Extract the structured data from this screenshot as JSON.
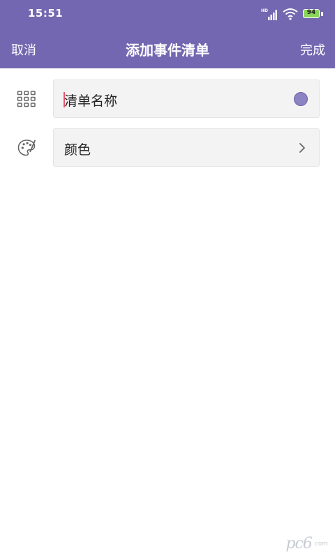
{
  "status_bar": {
    "time": "15:51",
    "battery_level": "94"
  },
  "navbar": {
    "cancel_label": "取消",
    "title": "添加事件清单",
    "done_label": "完成"
  },
  "form": {
    "name_field": {
      "placeholder": "清单名称",
      "icon": "grid-icon",
      "selected_color": "#8c83c2"
    },
    "color_field": {
      "label": "颜色",
      "icon": "palette-icon"
    }
  },
  "colors": {
    "accent": "#7467b1",
    "field_background": "#f3f3f3"
  },
  "watermark": {
    "logo": "pc6",
    "domain": "com"
  }
}
